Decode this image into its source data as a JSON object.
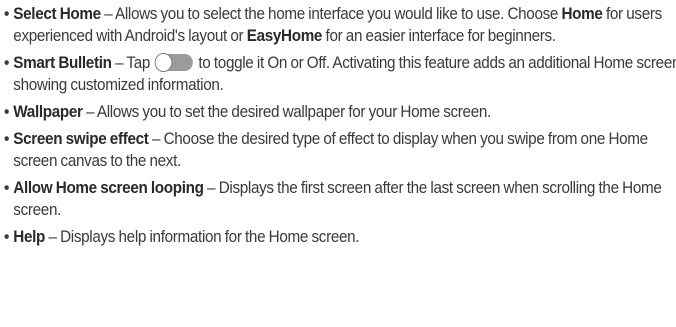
{
  "items": [
    {
      "term": "Select Home",
      "dash": " – ",
      "t1": "Allows you to select the home interface you would like to use. Choose ",
      "b1": "Home",
      "t2": " for users experienced with Android's layout or ",
      "b2": "EasyHome",
      "t3": " for an easier interface for beginners."
    },
    {
      "term": "Smart Bulletin",
      "dash": " – ",
      "t1": "Tap",
      "toggle_icon": "toggle-switch-off-icon",
      "t2": "to toggle it On or Off. Activating this feature adds an additional Home screen showing customized information."
    },
    {
      "term": "Wallpaper",
      "dash": " – ",
      "t1": "Allows you to set the desired wallpaper for your Home screen."
    },
    {
      "term": "Screen swipe effect",
      "dash": " – ",
      "t1": "Choose the desired type of effect to display when you swipe from one Home screen canvas to the next."
    },
    {
      "term": "Allow Home screen looping",
      "dash": " – ",
      "t1": "Displays the first screen after the last screen when scrolling the Home screen."
    },
    {
      "term": "Help",
      "dash": " – ",
      "t1": "Displays help information for the Home screen."
    }
  ],
  "bullet": "•"
}
